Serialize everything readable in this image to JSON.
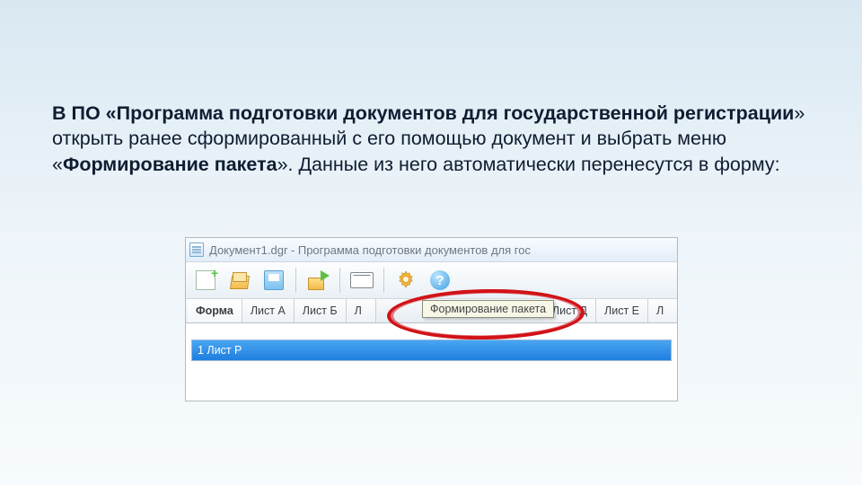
{
  "body": {
    "prefix": "В ПО «",
    "bold1": "Программа подготовки документов для государственной регистрации",
    "mid": "» открыть ранее сформированный с его помощью документ и выбрать меню «",
    "bold2": "Формирование пакета",
    "suffix": "». Данные из него автоматически перенесутся в форму:"
  },
  "titlebar": {
    "text": "Документ1.dgr - Программа подготовки документов для гос"
  },
  "tabs": {
    "t0": "Форма",
    "t1": "Лист А",
    "t2": "Лист Б",
    "t3": "Л",
    "t4": "Лист Д",
    "t5": "Лист Е",
    "t6": "Л"
  },
  "tooltip": {
    "text": "Формирование пакета"
  },
  "list": {
    "row0": "1 Лист Р"
  },
  "help_glyph": "?"
}
